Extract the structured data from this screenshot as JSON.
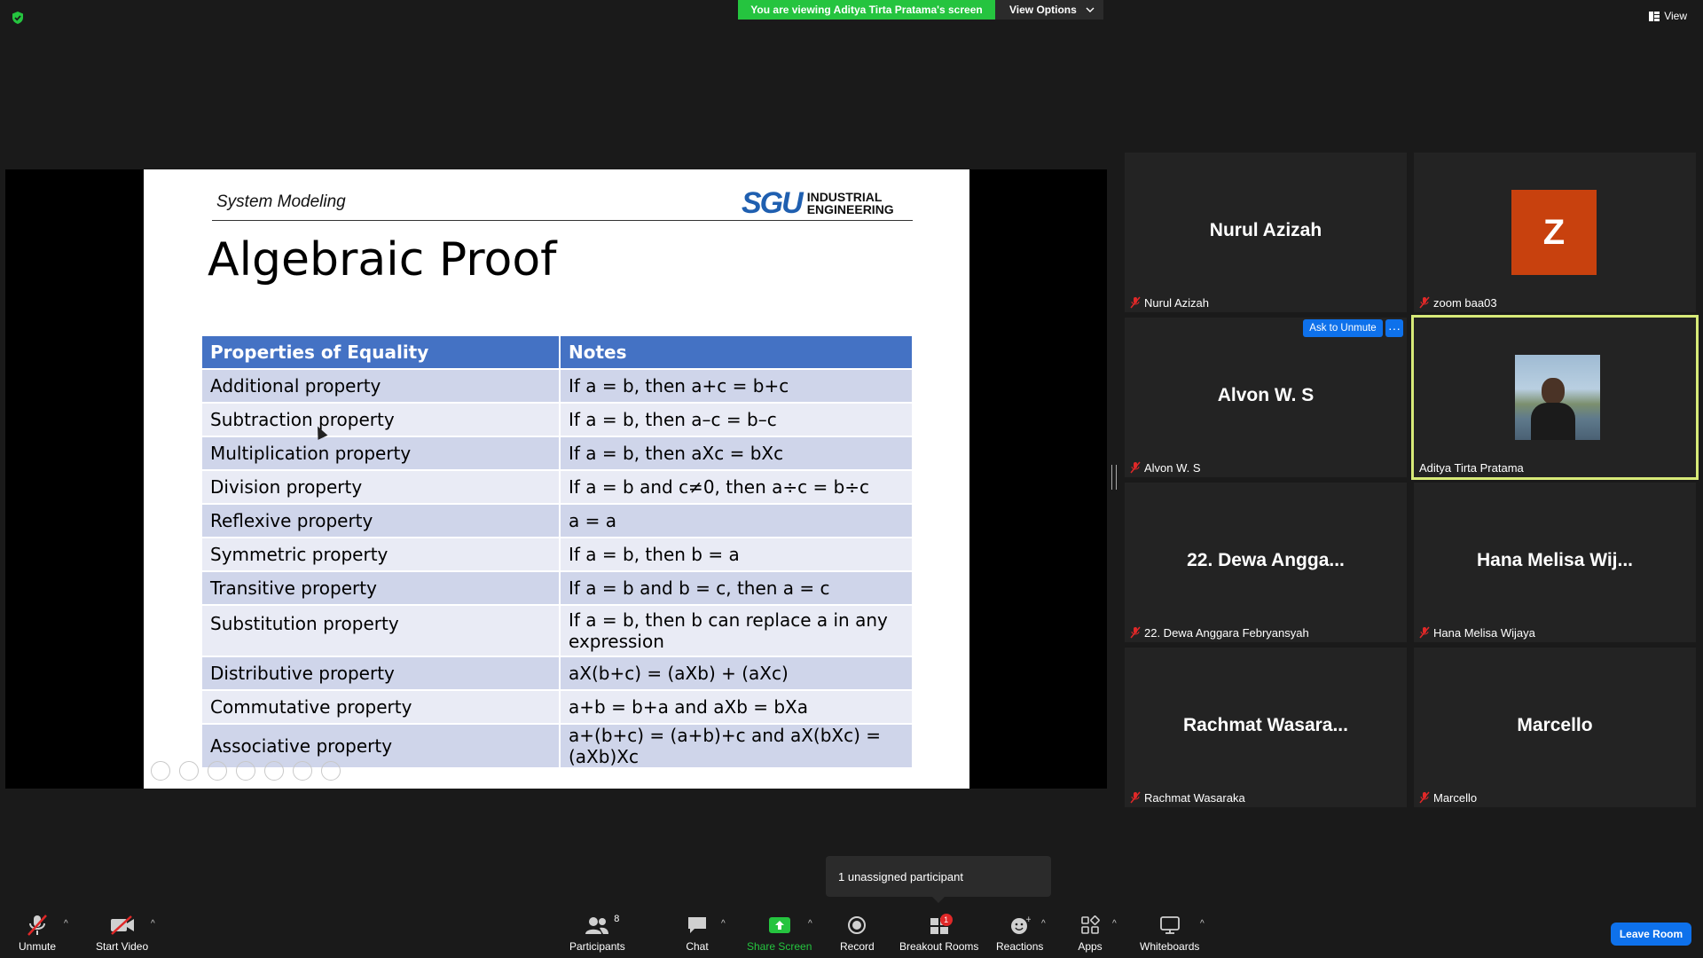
{
  "top_bar": {
    "viewing_banner": "You are viewing Aditya Tirta Pratama's screen",
    "view_options_label": "View Options",
    "view_label": "View"
  },
  "slide": {
    "header_text": "System Modeling",
    "logo_mark": "SGU",
    "logo_line1": "INDUSTRIAL",
    "logo_line2": "ENGINEERING",
    "title": "Algebraic Proof",
    "table": {
      "headers": [
        "Properties of Equality",
        "Notes"
      ],
      "rows": [
        [
          "Additional property",
          "If a = b, then a+c = b+c"
        ],
        [
          "Subtraction property",
          "If a = b, then a–c = b–c"
        ],
        [
          "Multiplication property",
          "If a = b, then aXc = bXc"
        ],
        [
          "Division property",
          "If a = b and c≠0, then a÷c = b÷c"
        ],
        [
          "Reflexive property",
          "a = a"
        ],
        [
          "Symmetric property",
          "If a = b, then b = a"
        ],
        [
          "Transitive property",
          "If a = b and b = c, then a = c"
        ],
        [
          "Substitution property",
          "If a = b, then b can replace a in any expression"
        ],
        [
          "Distributive property",
          "aX(b+c) = (aXb) + (aXc)"
        ],
        [
          "Commutative property",
          "a+b = b+a and aXb = bXa"
        ],
        [
          "Associative property",
          "a+(b+c) = (a+b)+c and aX(bXc) = (aXb)Xc"
        ]
      ]
    }
  },
  "gallery": {
    "tiles": [
      {
        "display_name": "Nurul Azizah",
        "label": "Nurul Azizah",
        "muted": true
      },
      {
        "avatar_letter": "Z",
        "label": "zoom baa03",
        "muted": true
      },
      {
        "display_name": "Alvon W. S",
        "label": "Alvon W. S",
        "muted": true
      },
      {
        "label": "Aditya Tirta Pratama",
        "muted": false,
        "active_speaker": true
      },
      {
        "display_name": "22. Dewa Angga...",
        "label": "22. Dewa Anggara Febryansyah",
        "muted": true
      },
      {
        "display_name": "Hana Melisa Wij...",
        "label": "Hana Melisa Wijaya",
        "muted": true
      },
      {
        "display_name": "Rachmat Wasara...",
        "label": "Rachmat Wasaraka",
        "muted": true
      },
      {
        "display_name": "Marcello",
        "label": "Marcello",
        "muted": true
      }
    ],
    "ask_to_unmute": "Ask to Unmute",
    "more_label": "···"
  },
  "popover": {
    "text": "1 unassigned participant"
  },
  "toolbar": {
    "unmute": "Unmute",
    "start_video": "Start Video",
    "participants": "Participants",
    "participants_count": "8",
    "chat": "Chat",
    "share_screen": "Share Screen",
    "record": "Record",
    "breakout_rooms": "Breakout Rooms",
    "breakout_badge": "1",
    "reactions": "Reactions",
    "apps": "Apps",
    "whiteboards": "Whiteboards",
    "leave_room": "Leave Room"
  },
  "colors": {
    "banner_green": "#25c43f",
    "table_header_blue": "#4472c4",
    "zoom_blue": "#0e71eb",
    "active_speaker_border": "#d7ea78",
    "avatar_orange": "#c8410e"
  },
  "icons": [
    "shield-icon",
    "view-grid-icon",
    "chevron-down-icon",
    "mic-off-icon",
    "video-off-icon",
    "participants-icon",
    "chat-icon",
    "share-screen-icon",
    "record-icon",
    "breakout-rooms-icon",
    "reactions-icon",
    "apps-icon",
    "whiteboard-icon"
  ]
}
